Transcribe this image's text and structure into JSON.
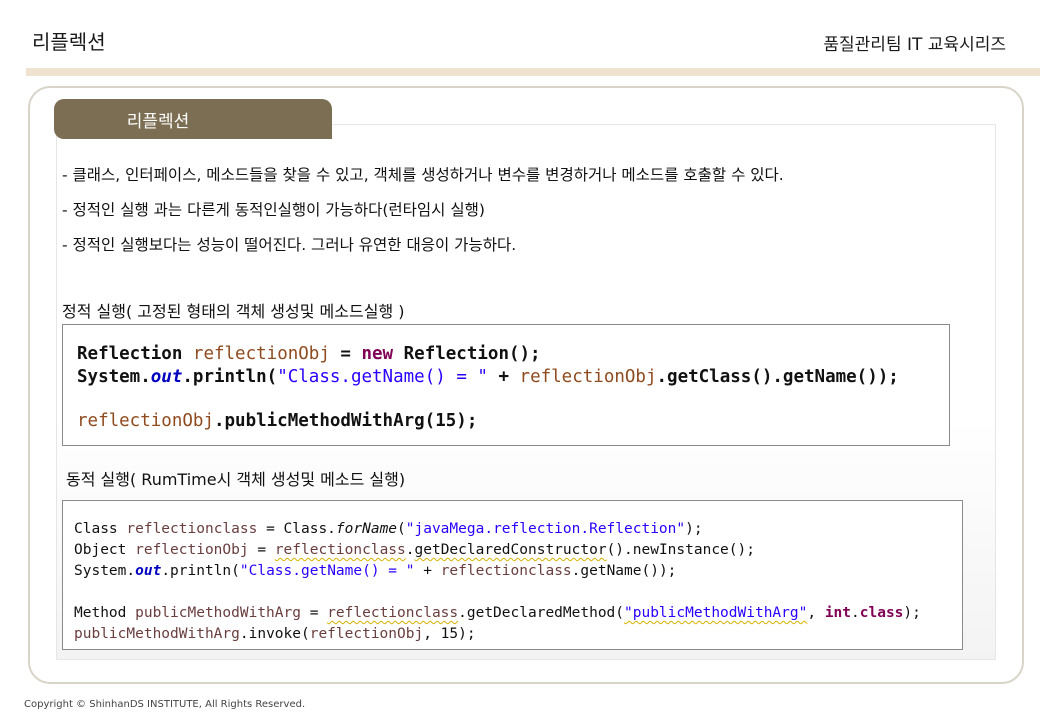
{
  "header": {
    "title": "리플렉션",
    "series": "품질관리팀 IT 교육시리즈"
  },
  "tab": {
    "label": "리플렉션"
  },
  "bullets": [
    "- 클래스, 인터페이스, 메소드들을 찾을 수 있고, 객체를 생성하거나 변수를 변경하거나 메소드를 호출할 수 있다.",
    "- 정적인 실행 과는 다른게 동적인실행이 가능하다(런타임시 실행)",
    "- 정적인 실행보다는 성능이 떨어진다.  그러나 유연한 대응이 가능하다."
  ],
  "static_section": {
    "title": "정적 실행( 고정된 형태의 객체 생성및 메소드실행 )",
    "code": {
      "line1": {
        "t1": "Reflection",
        "v1": "reflectionObj",
        "eq": " = ",
        "kw": "new",
        "t2": " Reflection();"
      },
      "line2": {
        "t1": "System.",
        "f": "out",
        "t2": ".println(",
        "s": "\"Class.getName() = \"",
        "t3": " + ",
        "v": "reflectionObj",
        "t4": ".getClass().getName());"
      },
      "line3": {
        "v": "reflectionObj",
        "t": ".publicMethodWithArg(15);"
      }
    }
  },
  "dynamic_section": {
    "title": "동적 실행( RumTime시 객체 생성및 메소드 실행)",
    "code": {
      "line1": {
        "t1": "Class ",
        "v1": "reflectionclass",
        "t2": " = Class.",
        "i": "forName",
        "t3": "(",
        "s": "\"javaMega.reflection.Reflection\"",
        "t4": ");"
      },
      "line2": {
        "t1": "Object ",
        "v1": "reflectionObj",
        "t2": " = ",
        "v2": "reflectionclass",
        "t3": ".",
        "m": "getDeclaredConstructor",
        "t4": "().newInstance();"
      },
      "line3": {
        "t1": "System.",
        "f": "out",
        "t2": ".println(",
        "s": "\"Class.getName() = \"",
        "t3": " + ",
        "v": "reflectionclass",
        "t4": ".getName());"
      },
      "line4": {
        "t1": "Method ",
        "v1": "publicMethodWithArg",
        "t2": " = ",
        "v2": "reflectionclass",
        "t3": ".getDeclaredMethod(",
        "s": "\"publicMethodWithArg\"",
        "t4": ", ",
        "kw": "int",
        "t5": ".",
        "kw2": "class",
        "t6": ");"
      },
      "line5": {
        "v1": "publicMethodWithArg",
        "t1": ".invoke(",
        "v2": "reflectionObj",
        "t2": ", 15);"
      }
    }
  },
  "footer": {
    "copyright": "Copyright © ShinhanDS INSTITUTE, All Rights Reserved."
  }
}
